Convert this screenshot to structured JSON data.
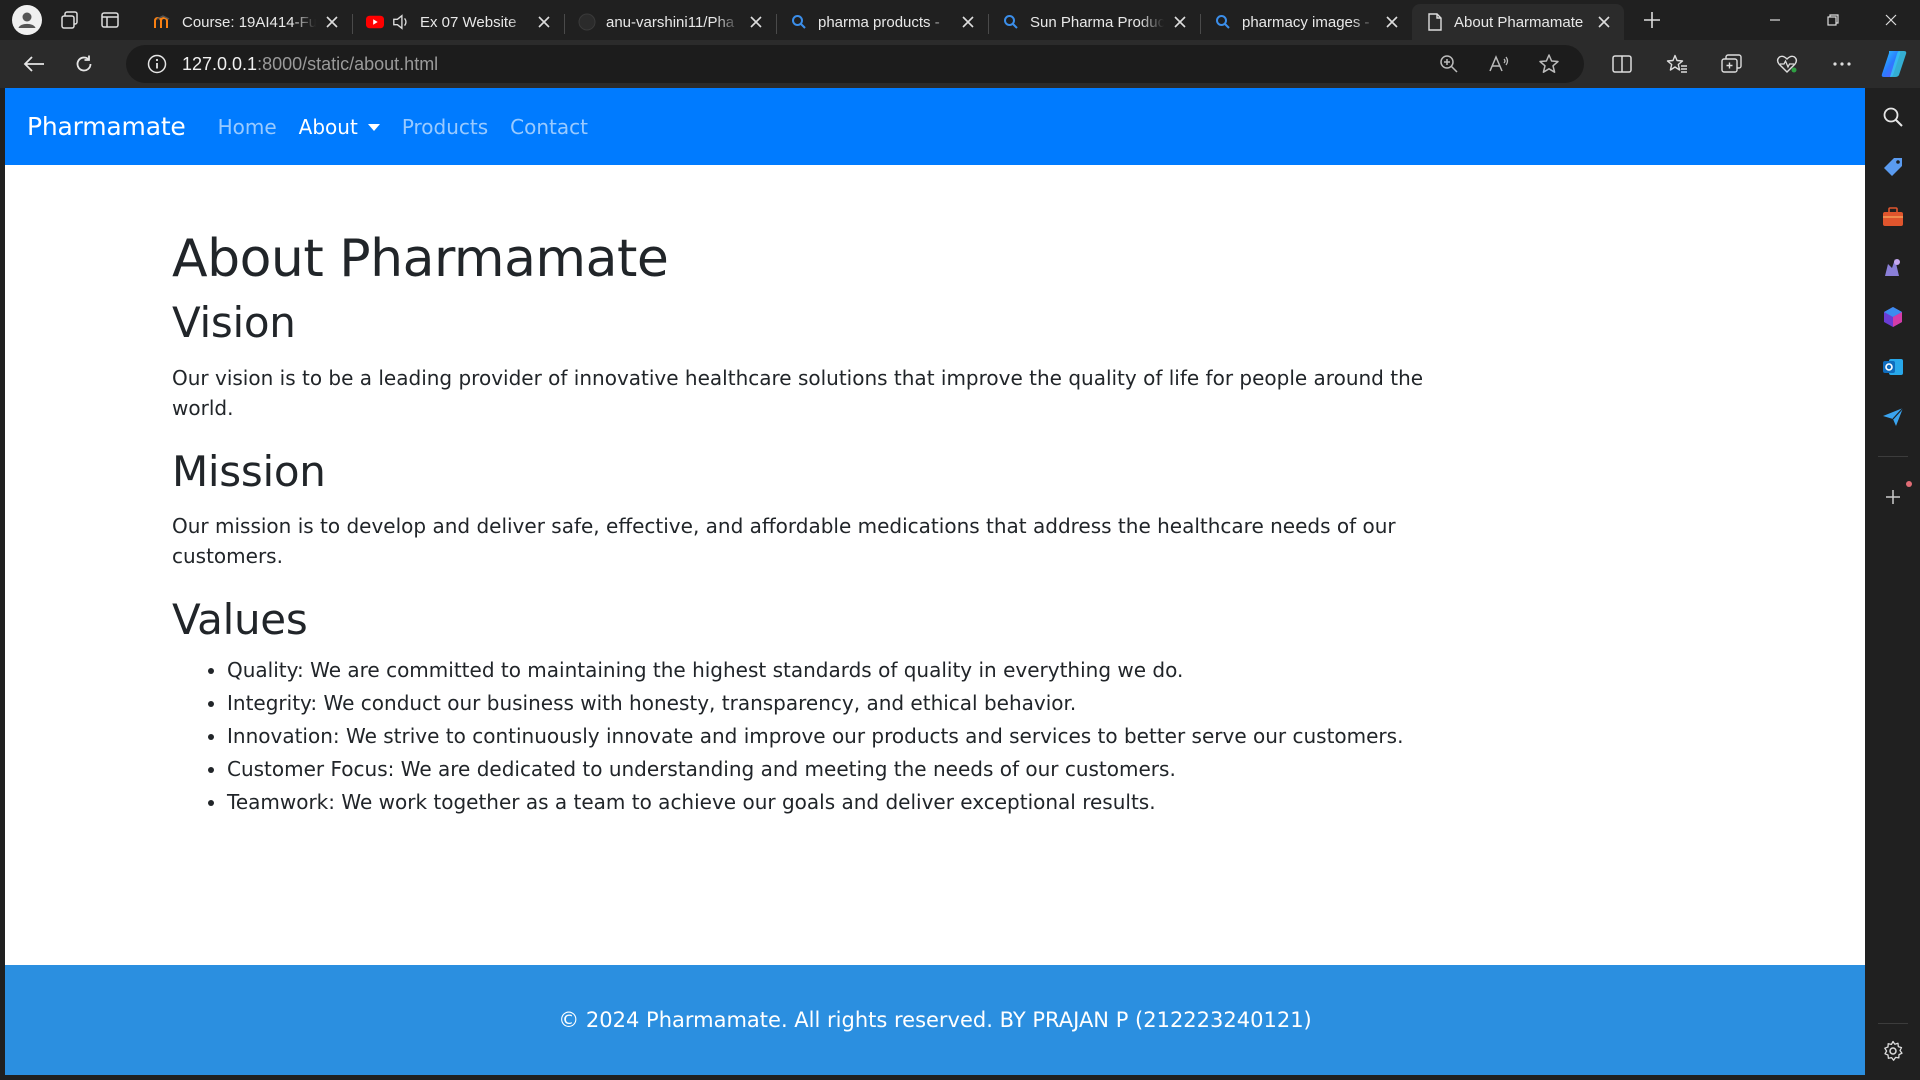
{
  "browser": {
    "tabs": [
      {
        "title": "Course: 19AI414-Fu",
        "favicon": "moodle-icon",
        "active": false
      },
      {
        "title": "Ex 07 Website",
        "favicon": "youtube-icon",
        "active": false
      },
      {
        "title": "anu-varshini11/Pha",
        "favicon": "github-icon",
        "active": false
      },
      {
        "title": "pharma products - ",
        "favicon": "bing-search-icon",
        "active": false
      },
      {
        "title": "Sun Pharma Produc",
        "favicon": "bing-search-icon",
        "active": false
      },
      {
        "title": "pharmacy images - ",
        "favicon": "bing-search-icon",
        "active": false
      },
      {
        "title": "About Pharmamate",
        "favicon": "page-icon",
        "active": true
      }
    ],
    "url_host": "127.0.0.1",
    "url_rest": ":8000/static/about.html"
  },
  "page": {
    "navbar": {
      "brand": "Pharmamate",
      "links": [
        {
          "label": "Home"
        },
        {
          "label": "About"
        },
        {
          "label": "Products"
        },
        {
          "label": "Contact"
        }
      ]
    },
    "title": "About Pharmamate",
    "vision": {
      "heading": "Vision",
      "text": "Our vision is to be a leading provider of innovative healthcare solutions that improve the quality of life for people around the world."
    },
    "mission": {
      "heading": "Mission",
      "text": "Our mission is to develop and deliver safe, effective, and affordable medications that address the healthcare needs of our customers."
    },
    "values": {
      "heading": "Values",
      "items": [
        "Quality: We are committed to maintaining the highest standards of quality in everything we do.",
        "Integrity: We conduct our business with honesty, transparency, and ethical behavior.",
        "Innovation: We strive to continuously innovate and improve our products and services to better serve our customers.",
        "Customer Focus: We are dedicated to understanding and meeting the needs of our customers.",
        "Teamwork: We work together as a team to achieve our goals and deliver exceptional results."
      ]
    },
    "footer": "© 2024 Pharmamate. All rights reserved. BY PRAJAN P (212223240121)"
  },
  "colors": {
    "navbar": "#007bff",
    "footer": "#2b8fe0",
    "browser_chrome": "#202020"
  }
}
